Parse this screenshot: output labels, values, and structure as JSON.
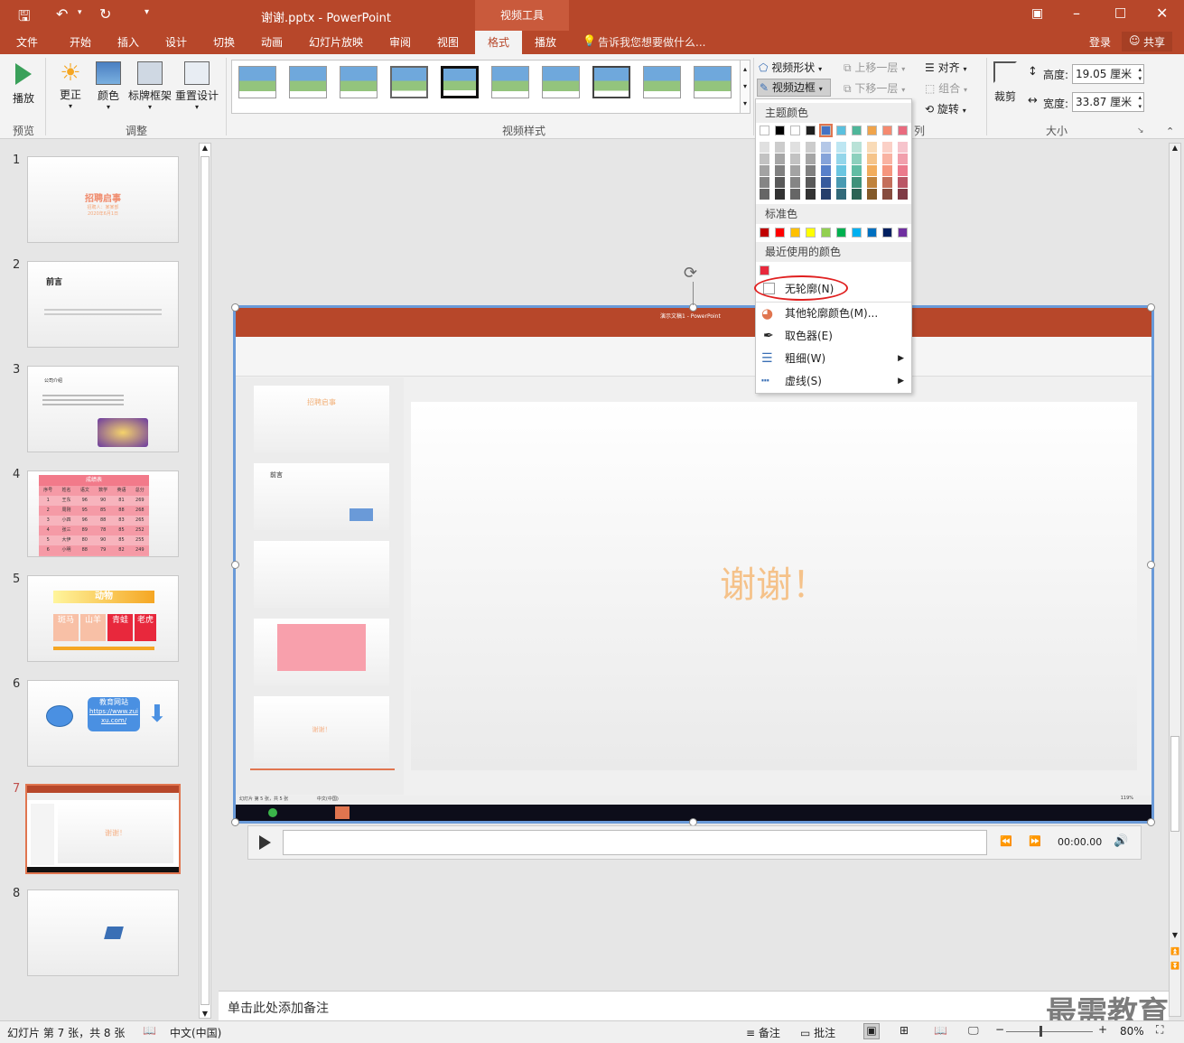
{
  "titlebar": {
    "title": "谢谢.pptx - PowerPoint",
    "tool_tab": "视频工具",
    "login": "登录",
    "share": "共享"
  },
  "menu": {
    "tabs": [
      "文件",
      "开始",
      "插入",
      "设计",
      "切换",
      "动画",
      "幻灯片放映",
      "审阅",
      "视图",
      "格式",
      "播放"
    ],
    "tellme": "告诉我您想要做什么..."
  },
  "ribbon": {
    "play": "播放",
    "correct": "更正",
    "color": "颜色",
    "poster": "标牌框架",
    "reset": "重置设计",
    "video_shape": "视频形状",
    "video_border": "视频边框",
    "bring_forward": "上移一层",
    "send_backward": "下移一层",
    "align": "对齐",
    "group": "组合",
    "rotate": "旋转",
    "crop": "裁剪",
    "height_label": "高度:",
    "height_value": "19.05 厘米",
    "width_label": "宽度:",
    "width_value": "33.87 厘米",
    "groups": {
      "preview": "预览",
      "adjust": "调整",
      "video_styles": "视频样式",
      "arrange_tail": "列",
      "size": "大小"
    }
  },
  "dropdown": {
    "theme_colors": "主题颜色",
    "standard_colors": "标准色",
    "recent_colors": "最近使用的颜色",
    "no_outline": "无轮廓(N)",
    "more_colors": "其他轮廓颜色(M)...",
    "eyedropper": "取色器(E)",
    "weight": "粗细(W)",
    "dashes": "虚线(S)",
    "theme_top": [
      "#ffffff",
      "#000000",
      "#ffffff",
      "#1f1f1f",
      "#4472c4",
      "#5bc0de",
      "#4fb69a",
      "#f0a44b",
      "#f58a70",
      "#e96b7f"
    ],
    "standard": [
      "#c00000",
      "#ff0000",
      "#ffc000",
      "#ffff00",
      "#92d050",
      "#00b050",
      "#00b0f0",
      "#0070c0",
      "#002060",
      "#7030a0"
    ],
    "recent": [
      "#e8283c"
    ]
  },
  "slides": [
    {
      "num": "1",
      "title": "招聘启事",
      "sub1": "招聘人：某某部",
      "sub2": "2020年6月1日"
    },
    {
      "num": "2",
      "title": "前言"
    },
    {
      "num": "3",
      "title": "公司介绍"
    },
    {
      "num": "4",
      "title": "成绩表",
      "headers": [
        "序号",
        "姓名",
        "语文",
        "数学",
        "英语",
        "总分"
      ],
      "rows": [
        [
          "1",
          "王东",
          "96",
          "90",
          "81",
          "269"
        ],
        [
          "2",
          "周刚",
          "95",
          "85",
          "88",
          "268"
        ],
        [
          "3",
          "小四",
          "96",
          "88",
          "83",
          "265"
        ],
        [
          "4",
          "张三",
          "89",
          "78",
          "85",
          "252"
        ],
        [
          "5",
          "大伊",
          "80",
          "90",
          "85",
          "255"
        ],
        [
          "6",
          "小明",
          "88",
          "79",
          "82",
          "249"
        ]
      ]
    },
    {
      "num": "5",
      "title": "动物",
      "cells": [
        "斑马",
        "山羊",
        "青蛙",
        "老虎"
      ]
    },
    {
      "num": "6",
      "button": "教育网站",
      "link": "https://www.zuixu.com/"
    },
    {
      "num": "7",
      "text": "谢谢！"
    },
    {
      "num": "8"
    }
  ],
  "main_slide": {
    "text": "谢谢！",
    "inner_title": "演示文稿1 - PowerPoint",
    "inner_status": "幻灯片 第 5 张，共 5 张",
    "inner_lang": "中文(中国)",
    "inner_zoom": "119%"
  },
  "player": {
    "time": "00:00.00"
  },
  "notes": {
    "placeholder": "单击此处添加备注"
  },
  "status": {
    "slide_info": "幻灯片 第 7 张，共 8 张",
    "language": "中文(中国)",
    "notes": "备注",
    "comments": "批注",
    "zoom": "80%"
  },
  "watermark": "最需教育",
  "colors": {
    "accent": "#b7472a",
    "selection": "#6a9ad8",
    "highlight_circle": "#e02020"
  }
}
